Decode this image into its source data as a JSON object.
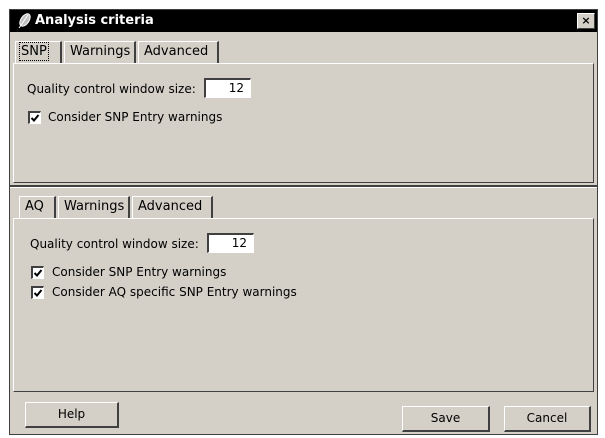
{
  "window": {
    "title": "Analysis criteria",
    "close_glyph": "×",
    "title_icon": "feather-icon"
  },
  "snp_panel": {
    "tabs": [
      "SNP",
      "Warnings",
      "Advanced"
    ],
    "active_tab": 0,
    "qc_label": "Quality control window size:",
    "qc_value": "12",
    "checkboxes": [
      {
        "label": "Consider SNP Entry warnings",
        "checked": true
      }
    ]
  },
  "aq_panel": {
    "tabs": [
      "AQ",
      "Warnings",
      "Advanced"
    ],
    "active_tab": 0,
    "qc_label": "Quality control window size:",
    "qc_value": "12",
    "checkboxes": [
      {
        "label": "Consider SNP Entry warnings",
        "checked": true
      },
      {
        "label": "Consider AQ specific SNP Entry warnings",
        "checked": true
      }
    ]
  },
  "buttons": {
    "help": "Help",
    "save": "Save",
    "cancel": "Cancel"
  }
}
